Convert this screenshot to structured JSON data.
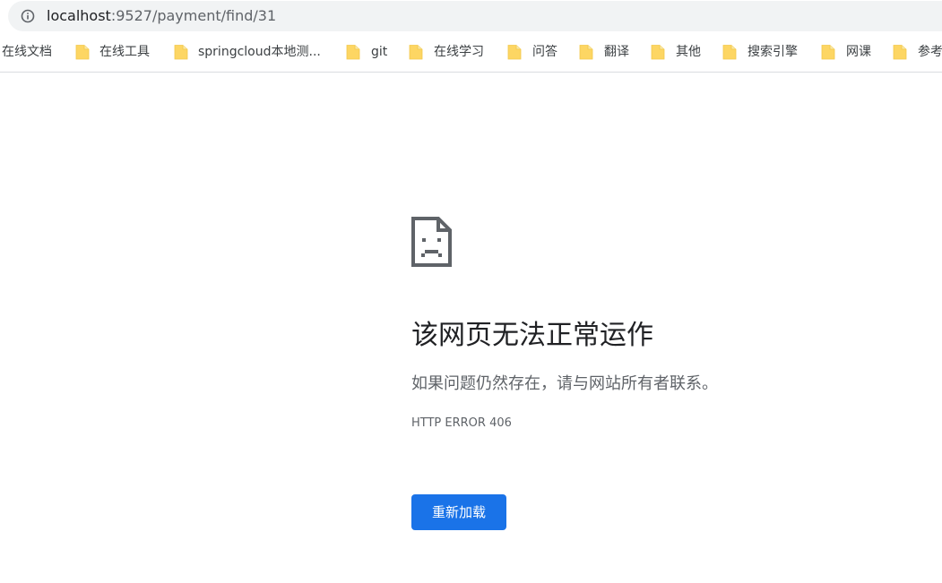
{
  "address_bar": {
    "url_host": "localhost",
    "url_rest": ":9527/payment/find/31",
    "icon": "info-icon"
  },
  "bookmarks": {
    "folder_icon": "folder-icon",
    "folder_color": "#fdd663",
    "items": [
      {
        "label": "在线文档",
        "has_folder": false
      },
      {
        "label": "在线工具",
        "has_folder": true
      },
      {
        "label": "springcloud本地测...",
        "has_folder": true
      },
      {
        "label": "git",
        "has_folder": true
      },
      {
        "label": "在线学习",
        "has_folder": true
      },
      {
        "label": "问答",
        "has_folder": true
      },
      {
        "label": "翻译",
        "has_folder": true
      },
      {
        "label": "其他",
        "has_folder": true
      },
      {
        "label": "搜索引擎",
        "has_folder": true
      },
      {
        "label": "网课",
        "has_folder": true
      },
      {
        "label": "参考",
        "has_folder": true
      }
    ]
  },
  "error_page": {
    "icon": "sad-page-icon",
    "title": "该网页无法正常运作",
    "description": "如果问题仍然存在，请与网站所有者联系。",
    "error_code": "HTTP ERROR 406",
    "reload_label": "重新加载",
    "accent_color": "#1a73e8"
  }
}
